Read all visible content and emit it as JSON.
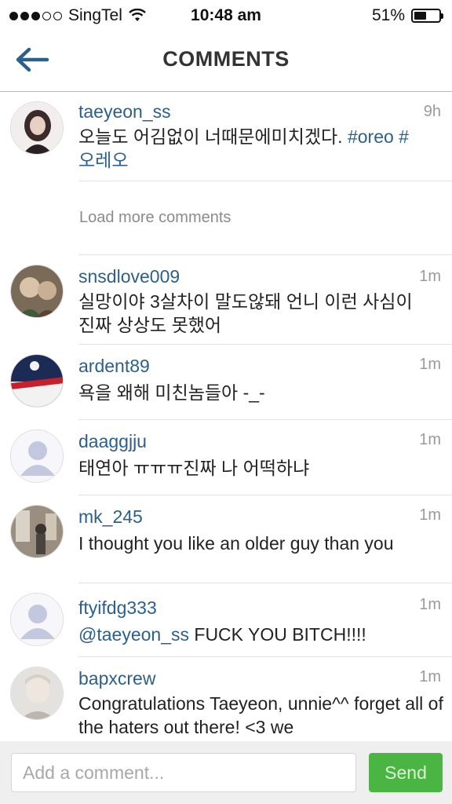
{
  "status_bar": {
    "carrier": "SingTel",
    "time": "10:48 am",
    "battery": "51%",
    "battery_level": 0.51,
    "signal_bars": 3,
    "signal_total": 5
  },
  "header": {
    "title": "COMMENTS",
    "back_icon": "back-arrow-icon"
  },
  "caption": {
    "username": "taeyeon_ss",
    "time": "9h",
    "text_line1": "오늘도 어김없이 너때문에미치겠다. ",
    "hashtag1": "#oreo",
    "hashtag2_part1": " #",
    "hashtag2_part2": "오레오"
  },
  "load_more": "Load more comments",
  "comments": [
    {
      "username": "snsdlove009",
      "time": "1m",
      "text": "실망이야 3살차이 말도않돼 언니 이런 사심이 진짜 상상도 못했어"
    },
    {
      "username": "ardent89",
      "time": "1m",
      "text": "욕을 왜해 미친놈들아 -_-"
    },
    {
      "username": "daaggjju",
      "time": "1m",
      "text": "태연아 ㅠㅠㅠ진짜 나 어떡하냐"
    },
    {
      "username": "mk_245",
      "time": "1m",
      "text": "I thought you like an older guy than you"
    },
    {
      "username": "ftyifdg333",
      "time": "1m",
      "mention": "@taeyeon_ss",
      "text": " FUCK YOU BITCH!!!!"
    },
    {
      "username": "bapxcrew",
      "time": "1m",
      "text": "Congratulations Taeyeon, unnie^^ forget all of the haters out there! <3 we"
    }
  ],
  "composer": {
    "placeholder": "Add a comment...",
    "send_label": "Send"
  },
  "colors": {
    "link": "#2c5f8a",
    "send": "#4bb543",
    "muted": "#9a9a9a"
  }
}
